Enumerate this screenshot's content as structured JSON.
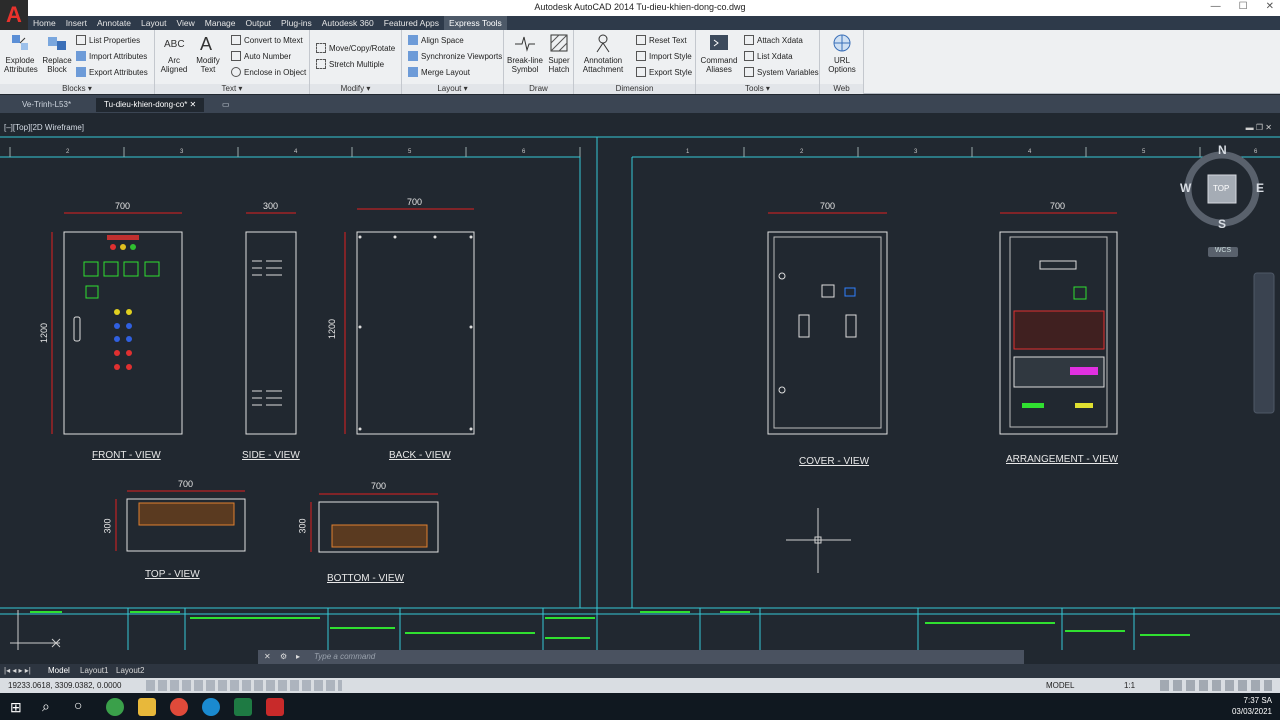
{
  "window": {
    "title": "Autodesk AutoCAD 2014    Tu-dieu-khien-dong-co.dwg"
  },
  "menu_tabs": [
    "Home",
    "Insert",
    "Annotate",
    "Layout",
    "View",
    "Manage",
    "Output",
    "Plug-ins",
    "Autodesk 360",
    "Featured Apps",
    "Express Tools"
  ],
  "active_menu_tab": "Express Tools",
  "ribbon": {
    "blocks": {
      "label": "Blocks ▾",
      "explode": "Explode\nAttributes",
      "replace": "Replace\nBlock",
      "list_props": "List Properties",
      "import_attr": "Import Attributes",
      "export_attr": "Export Attributes"
    },
    "text": {
      "label": "Text ▾",
      "arc_aligned": "Arc\nAligned",
      "modify_text": "Modify\nText",
      "convert_mtext": "Convert to Mtext",
      "auto_number": "Auto Number",
      "enclose": "Enclose in Object"
    },
    "modify": {
      "label": "Modify ▾",
      "move_copy": "Move/Copy/Rotate",
      "stretch": "Stretch Multiple"
    },
    "layout": {
      "label": "Layout ▾",
      "align_space": "Align Space",
      "sync_viewports": "Synchronize Viewports",
      "merge_layout": "Merge Layout"
    },
    "draw": {
      "label": "Draw",
      "break_line": "Break-line\nSymbol",
      "super_hatch": "Super\nHatch"
    },
    "dimension": {
      "label": "Dimension",
      "annotation_attach": "Annotation\nAttachment",
      "reset_text": "Reset Text",
      "import_style": "Import Style",
      "export_style": "Export Style"
    },
    "tools": {
      "label": "Tools ▾",
      "command_aliases": "Command\nAliases",
      "attach_xdata": "Attach Xdata",
      "list_xdata": "List Xdata",
      "system_vars": "System Variables"
    },
    "web": {
      "label": "Web",
      "url_options": "URL\nOptions"
    }
  },
  "doc_tabs": [
    "Ve-Trinh-L53*",
    "Tu-dieu-khien-dong-co*"
  ],
  "viewport_label": "[–][Top][2D Wireframe]",
  "views": {
    "front": "FRONT - VIEW",
    "side": "SIDE - VIEW",
    "back": "BACK - VIEW",
    "top": "TOP - VIEW",
    "bottom": "BOTTOM - VIEW",
    "cover": "COVER - VIEW",
    "arrangement": "ARRANGEMENT - VIEW"
  },
  "dims": {
    "w700": "700",
    "w300": "300",
    "h1200": "1200",
    "h300": "300"
  },
  "ruler_left": [
    "2",
    "3",
    "4",
    "5",
    "6"
  ],
  "ruler_right": [
    "1",
    "2",
    "3",
    "4",
    "5",
    "6"
  ],
  "compass": {
    "n": "N",
    "s": "S",
    "e": "E",
    "w": "W",
    "top": "TOP",
    "wcs": "WCS"
  },
  "command_placeholder": "Type a command",
  "layout_tabs": [
    "Model",
    "Layout1",
    "Layout2"
  ],
  "status": {
    "coords": "19233.0618, 3309.0382, 0.0000",
    "model": "MODEL",
    "scale": "1:1"
  },
  "tray": {
    "time": "7:37 SA",
    "date": "03/03/2021"
  }
}
